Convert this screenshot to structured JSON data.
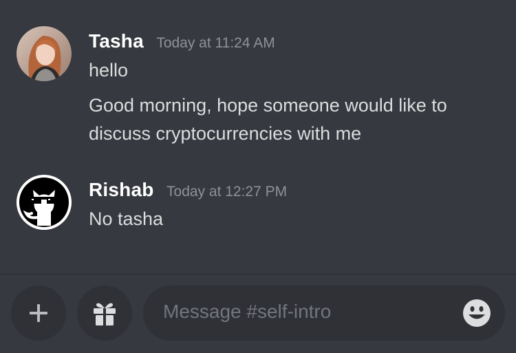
{
  "messages": [
    {
      "author": "Tasha",
      "timestamp": "Today at 11:24 AM",
      "lines": [
        "hello",
        "Good morning, hope someone would like to",
        "discuss cryptocurrencies with me"
      ],
      "avatar": "woman-photo-avatar"
    },
    {
      "author": "Rishab",
      "timestamp": "Today at 12:27 PM",
      "lines": [
        "No tasha"
      ],
      "avatar": "cat-with-sunglasses-avatar"
    }
  ],
  "composer": {
    "placeholder": "Message #self-intro",
    "buttons": [
      "plus-icon",
      "gift-icon",
      "emoji-icon"
    ]
  },
  "colors": {
    "background": "#36393f",
    "input_background": "#2f3136",
    "author": "#ffffff",
    "text": "#dcddde",
    "timestamp": "#8e9297"
  }
}
